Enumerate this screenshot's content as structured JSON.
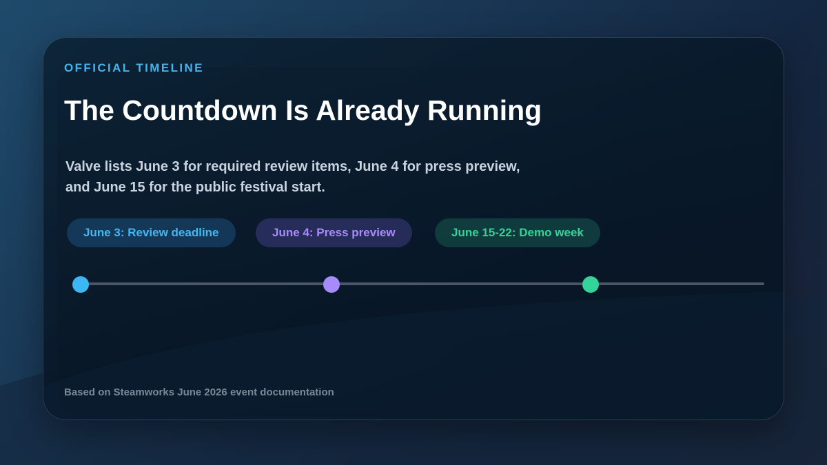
{
  "eyebrow": "OFFICIAL TIMELINE",
  "title": "The Countdown Is Already Running",
  "lede": "Valve lists June 3 for required review items, June 4 for press preview, and June 15 for the public festival start.",
  "milestones": [
    {
      "label": "June 3: Review deadline",
      "color": "#3bb7f4"
    },
    {
      "label": "June 4: Press preview",
      "color": "#a78bfa"
    },
    {
      "label": "June 15-22: Demo week",
      "color": "#34d399"
    }
  ],
  "footer": "Based on Steamworks June 2026 event documentation"
}
